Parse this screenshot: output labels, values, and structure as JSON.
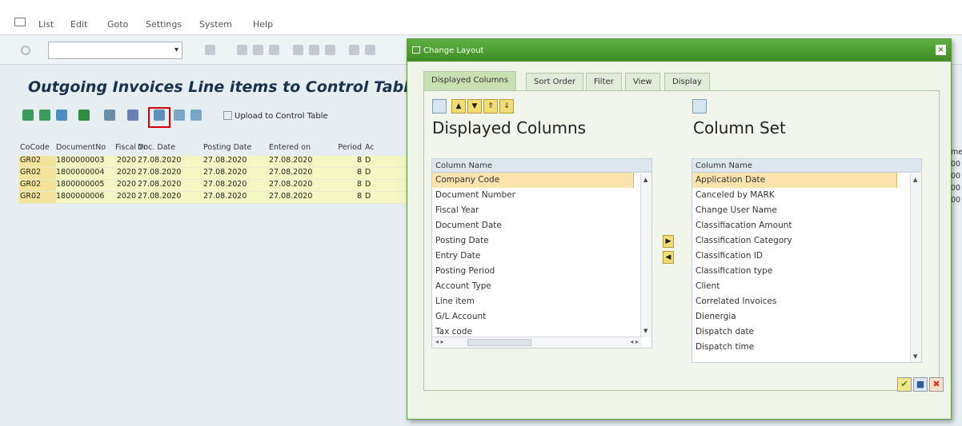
{
  "menu": {
    "items": [
      "List",
      "Edit",
      "Goto",
      "Settings",
      "System",
      "Help"
    ]
  },
  "toolbar": {
    "command_field_value": ""
  },
  "page": {
    "title": "Outgoing Invoices Line items to Control Table",
    "upload_label": "Upload to Control Table"
  },
  "grid": {
    "headers": [
      "CoCode",
      "DocumentNo",
      "Fiscal Yr",
      "Doc. Date",
      "Posting Date",
      "Entered on",
      "Period",
      "Ac"
    ],
    "rows": [
      [
        "GR02",
        "1800000003",
        "2020",
        "27.08.2020",
        "27.08.2020",
        "27.08.2020",
        "8",
        "D"
      ],
      [
        "GR02",
        "1800000004",
        "2020",
        "27.08.2020",
        "27.08.2020",
        "27.08.2020",
        "8",
        "D"
      ],
      [
        "GR02",
        "1800000005",
        "2020",
        "27.08.2020",
        "27.08.2020",
        "27.08.2020",
        "8",
        "D"
      ],
      [
        "GR02",
        "1800000006",
        "2020",
        "27.08.2020",
        "27.08.2020",
        "27.08.2020",
        "8",
        "D"
      ]
    ],
    "right_col": [
      "me",
      "00",
      "00",
      "00",
      "00"
    ]
  },
  "dialog": {
    "title": "Change Layout",
    "tabs": [
      "Displayed Columns",
      "Sort Order",
      "Filter",
      "View",
      "Display"
    ],
    "displayed": {
      "title": "Displayed Columns",
      "header": "Column Name",
      "items": [
        "Company Code",
        "Document Number",
        "Fiscal Year",
        "Document Date",
        "Posting Date",
        "Entry Date",
        "Posting Period",
        "Account Type",
        "Line item",
        "G/L Account",
        "Tax code"
      ]
    },
    "column_set": {
      "title": "Column Set",
      "header": "Column Name",
      "items": [
        "Application Date",
        "Canceled by MARK",
        "Change User Name",
        "Classifiacation Amount",
        "Classification Category",
        "Classification ID",
        "Classification type",
        "Client",
        "Correlated Invoices",
        "Dienergia",
        "Dispatch date",
        "Dispatch time"
      ]
    }
  }
}
